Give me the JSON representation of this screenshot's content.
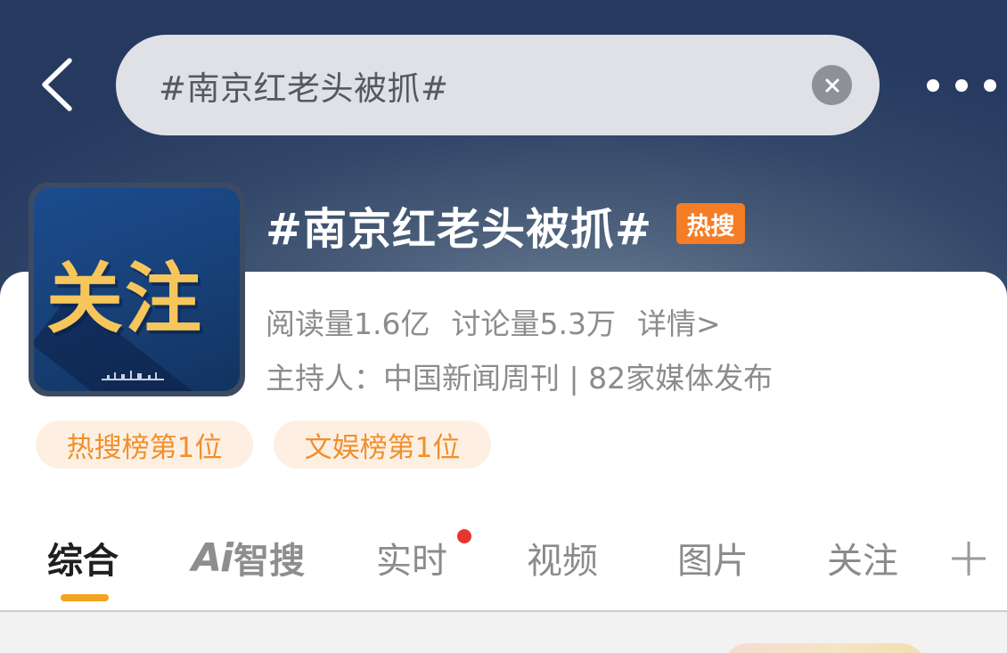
{
  "search": {
    "query": "#南京红老头被抓#"
  },
  "topic": {
    "title": "#南京红老头被抓#",
    "hot_badge": "热搜",
    "cover_text": "关注",
    "reads": "阅读量1.6亿",
    "discussions": "讨论量5.3万",
    "details_link": "详情>",
    "host_line": "主持人：中国新闻周刊 | 82家媒体发布",
    "ranks": [
      "热搜榜第1位",
      "文娱榜第1位"
    ]
  },
  "tabs": {
    "comprehensive": "综合",
    "ai_prefix": "Ai",
    "ai_search": "智搜",
    "realtime": "实时",
    "video": "视频",
    "images": "图片",
    "follow": "关注",
    "active_tab": "综合"
  },
  "colors": {
    "header_dark": "#263a60",
    "accent_orange": "#f47d26",
    "tab_indicator": "#f4a31e",
    "rank_chip_bg": "#fdf0e3",
    "rank_chip_text": "#f08f2d",
    "notification_dot": "#e8352d"
  },
  "icons": {
    "back": "chevron-left-icon",
    "clear": "close-circle-icon",
    "more": "more-dots-icon",
    "add_tab": "plus-icon"
  }
}
